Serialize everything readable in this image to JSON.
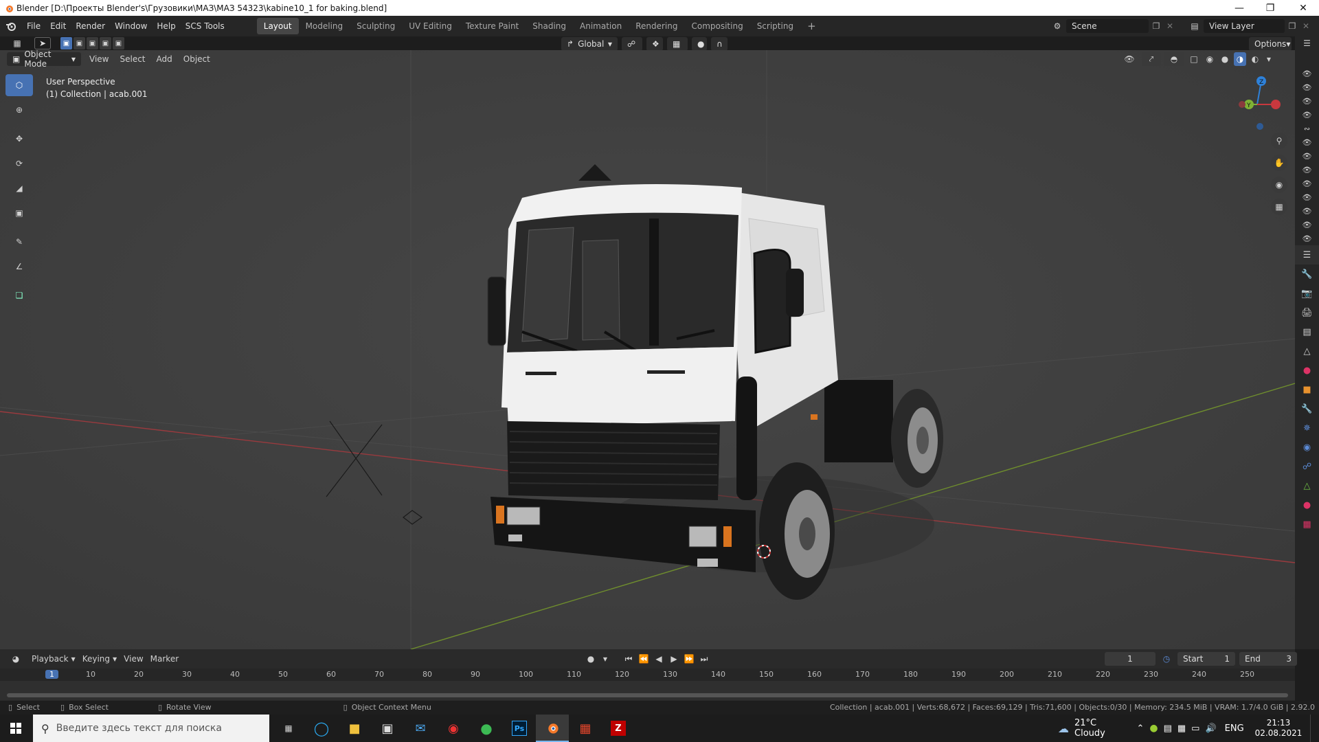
{
  "window": {
    "title": "Blender [D:\\Проекты Blender's\\Грузовики\\МАЗ\\МАЗ 54323\\kabine10_1 for baking.blend]"
  },
  "menu": [
    "File",
    "Edit",
    "Render",
    "Window",
    "Help",
    "SCS Tools"
  ],
  "workspaces": [
    "Layout",
    "Modeling",
    "Sculpting",
    "UV Editing",
    "Texture Paint",
    "Shading",
    "Animation",
    "Rendering",
    "Compositing",
    "Scripting"
  ],
  "header": {
    "transform_orientation": "Global",
    "options": "Options",
    "scene": "Scene",
    "view_layer": "View Layer"
  },
  "viewport_header": {
    "mode": "Object Mode",
    "menus": [
      "View",
      "Select",
      "Add",
      "Object"
    ]
  },
  "overlay": {
    "perspective": "User Perspective",
    "collection": "(1) Collection | acab.001"
  },
  "timeline": {
    "menus": [
      "Playback",
      "Keying",
      "View",
      "Marker"
    ],
    "current_frame": "1",
    "start_label": "Start",
    "start": "1",
    "end_label": "End",
    "end": "3",
    "ticks": [
      "1",
      "10",
      "20",
      "30",
      "40",
      "50",
      "60",
      "70",
      "80",
      "90",
      "100",
      "110",
      "120",
      "130",
      "140",
      "150",
      "160",
      "170",
      "180",
      "190",
      "200",
      "210",
      "220",
      "230",
      "240",
      "250"
    ]
  },
  "status": {
    "select": "Select",
    "box_select": "Box Select",
    "rotate": "Rotate View",
    "context": "Object Context Menu",
    "stats": "Collection | acab.001 | Verts:68,672 | Faces:69,129 | Tris:71,600 | Objects:0/30 | Memory: 234.5 MiB | VRAM: 1.7/4.0 GiB | 2.92.0"
  },
  "taskbar": {
    "search_placeholder": "Введите здесь текст для поиска",
    "weather": "21°C  Cloudy",
    "lang": "ENG",
    "time": "21:13",
    "date": "02.08.2021"
  },
  "colors": {
    "accent": "#4772b3",
    "x_axis": "#c8383e",
    "y_axis": "#7fb234",
    "z_axis": "#2e81d9"
  }
}
